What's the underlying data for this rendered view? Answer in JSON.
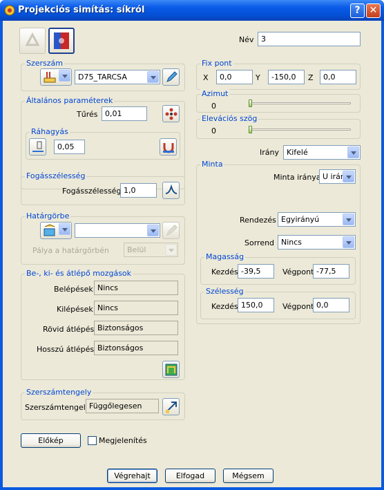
{
  "window": {
    "title": "Projekciós simítás: síkról",
    "help_icon": "question-mark",
    "close_icon": "close-x"
  },
  "nev": {
    "label": "Név",
    "value": "3"
  },
  "szerszam": {
    "title": "Szerszám",
    "tool": "D75_TARCSA"
  },
  "altalanos": {
    "title": "Általános paraméterek",
    "tures_label": "Tűrés",
    "tures_value": "0,01",
    "rahagyas": {
      "title": "Ráhagyás",
      "value": "0,05"
    }
  },
  "fogasszelesseg": {
    "title": "Fogásszélesség",
    "label": "Fogásszélesség",
    "value": "1,0"
  },
  "hatargorbe": {
    "title": "Határgörbe",
    "value": "",
    "palya_label": "Pálya a határgörbén",
    "palya_value": "Belül"
  },
  "mozgasok": {
    "title": "Be-, ki- és átlépő mozgások",
    "rows": [
      {
        "label": "Belépések",
        "value": "Nincs"
      },
      {
        "label": "Kilépések",
        "value": "Nincs"
      },
      {
        "label": "Rövid átlépés",
        "value": "Biztonságos"
      },
      {
        "label": "Hosszú átlépés",
        "value": "Biztonságos"
      }
    ]
  },
  "szerszamtengely": {
    "title": "Szerszámtengely",
    "label": "Szerszámtengely",
    "value": "Függőlegesen"
  },
  "fixpont": {
    "title": "Fix pont",
    "x_label": "X",
    "x": "0,0",
    "y_label": "Y",
    "y": "-150,0",
    "z_label": "Z",
    "z": "0,0"
  },
  "azimut": {
    "title": "Azimut",
    "value": "0",
    "slider_fraction": 0
  },
  "elevacio": {
    "title": "Elevációs szög",
    "value": "0",
    "slider_fraction": 0
  },
  "irany": {
    "label": "Irány",
    "value": "Kifelé"
  },
  "minta": {
    "title": "Minta",
    "irany_label": "Minta iránya",
    "irany_value": "U irán",
    "rendezes_label": "Rendezés",
    "rendezes_value": "Egyirányú",
    "sorrend_label": "Sorrend",
    "sorrend_value": "Nincs",
    "magassag": {
      "title": "Magasság",
      "kezdes_label": "Kezdés",
      "kezdes": "-39,5",
      "vegpont_label": "Végpont",
      "vegpont": "-77,5"
    },
    "szelesseg": {
      "title": "Szélesség",
      "kezdes_label": "Kezdés",
      "kezdes": "150,0",
      "vegpont_label": "Végpont",
      "vegpont": "0,0"
    }
  },
  "bottom": {
    "elokep": "Előkép",
    "megjelenites": "Megjelenítés",
    "vegrehajt": "Végrehajt",
    "elfogad": "Elfogad",
    "megsem": "Mégsem"
  }
}
